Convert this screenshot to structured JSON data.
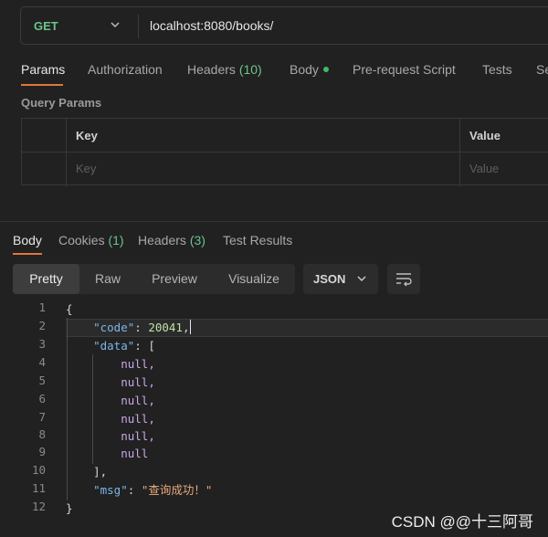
{
  "request": {
    "method": "GET",
    "url": "localhost:8080/books/"
  },
  "request_tabs": [
    {
      "label": "Params",
      "active": true
    },
    {
      "label": "Authorization"
    },
    {
      "label": "Headers",
      "count": "(10)"
    },
    {
      "label": "Body",
      "dot": true
    },
    {
      "label": "Pre-request Script"
    },
    {
      "label": "Tests"
    },
    {
      "label": "Se"
    }
  ],
  "query_params": {
    "title": "Query Params",
    "col_key": "Key",
    "col_value": "Value",
    "key_placeholder": "Key",
    "value_placeholder": "Value"
  },
  "response_tabs": [
    {
      "label": "Body",
      "active": true
    },
    {
      "label": "Cookies",
      "count": "(1)"
    },
    {
      "label": "Headers",
      "count": "(3)"
    },
    {
      "label": "Test Results"
    }
  ],
  "view_modes": [
    "Pretty",
    "Raw",
    "Preview",
    "Visualize"
  ],
  "active_view": "Pretty",
  "format": "JSON",
  "response_body": {
    "line_numbers": [
      "1",
      "2",
      "3",
      "4",
      "5",
      "6",
      "7",
      "8",
      "9",
      "10",
      "11",
      "12"
    ],
    "open_brace": "{",
    "code_key": "\"code\"",
    "code_value": "20041",
    "data_key": "\"data\"",
    "open_bracket": "[",
    "data_items": [
      "null,",
      "null,",
      "null,",
      "null,",
      "null,",
      "null"
    ],
    "close_bracket": "],",
    "msg_key": "\"msg\"",
    "msg_value": "\"查询成功！\"",
    "close_brace": "}"
  },
  "icons": {
    "method_dropdown": "chevron-down-icon",
    "format_dropdown": "chevron-down-icon",
    "wrap": "wrap-lines-icon"
  },
  "colors": {
    "accent": "#e2753a",
    "count": "#6bc48a",
    "key": "#7ab6e8",
    "number": "#bfe0a7",
    "null": "#c9a7e6",
    "string": "#e9a97a"
  },
  "watermark": "CSDN @@十三阿哥"
}
